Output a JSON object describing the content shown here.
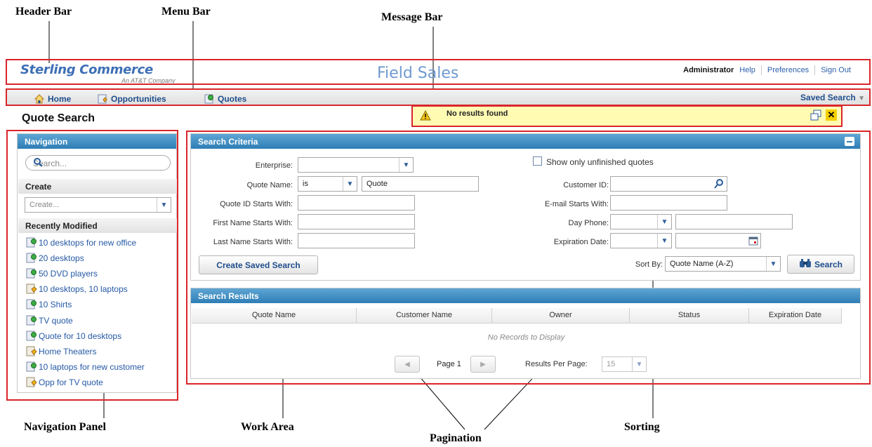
{
  "callouts": {
    "header_bar": "Header Bar",
    "menu_bar": "Menu Bar",
    "message_bar": "Message Bar",
    "navigation_panel": "Navigation Panel",
    "work_area": "Work Area",
    "pagination": "Pagination",
    "sorting": "Sorting"
  },
  "header": {
    "logo_main": "Sterling Commerce",
    "logo_sub": "An AT&T Company",
    "app_title": "Field Sales",
    "user": "Administrator",
    "links": [
      "Help",
      "Preferences",
      "Sign Out"
    ]
  },
  "menu": {
    "items": [
      "Home",
      "Opportunities",
      "Quotes"
    ],
    "saved_search": "Saved Search"
  },
  "message": {
    "text": "No results found",
    "icons": [
      "warning-icon",
      "popout-icon",
      "close-icon"
    ]
  },
  "page_title": "Quote Search",
  "navigation": {
    "title": "Navigation",
    "search_placeholder": "Search...",
    "create_header": "Create",
    "create_placeholder": "Create...",
    "recent_header": "Recently Modified",
    "recent": [
      {
        "label": "10 desktops for new office",
        "icon": "quote-icon"
      },
      {
        "label": "20 desktops",
        "icon": "quote-icon"
      },
      {
        "label": "50 DVD players",
        "icon": "quote-icon"
      },
      {
        "label": "10 desktops, 10 laptops",
        "icon": "opportunity-icon"
      },
      {
        "label": "10 Shirts",
        "icon": "quote-icon"
      },
      {
        "label": "TV quote",
        "icon": "quote-icon"
      },
      {
        "label": "Quote for 10 desktops",
        "icon": "quote-icon"
      },
      {
        "label": "Home Theaters",
        "icon": "opportunity-icon"
      },
      {
        "label": "10 laptops for new customer",
        "icon": "quote-icon"
      },
      {
        "label": "Opp for TV quote",
        "icon": "opportunity-icon"
      }
    ]
  },
  "search_criteria": {
    "title": "Search Criteria",
    "enterprise_label": "Enterprise:",
    "quote_name_label": "Quote Name:",
    "quote_name_operator": "is",
    "quote_name_value": "Quote",
    "quote_id_label": "Quote ID Starts With:",
    "first_name_label": "First Name Starts With:",
    "last_name_label": "Last Name Starts With:",
    "unfinished_label": "Show only unfinished quotes",
    "customer_id_label": "Customer ID:",
    "email_label": "E-mail Starts With:",
    "day_phone_label": "Day Phone:",
    "expiration_label": "Expiration Date:",
    "create_saved_search": "Create Saved Search",
    "sort_by_label": "Sort By:",
    "sort_by_value": "Quote Name (A-Z)",
    "search_button": "Search"
  },
  "search_results": {
    "title": "Search Results",
    "columns": [
      "Quote Name",
      "Customer Name",
      "Owner",
      "Status",
      "Expiration Date"
    ],
    "empty_text": "No Records to Display",
    "page_label": "Page 1",
    "results_per_page_label": "Results Per Page:",
    "results_per_page_value": "15"
  },
  "colors": {
    "annotation_red": "#d9262a",
    "panel_header_blue": "#2e7db5",
    "link_blue": "#2559a5",
    "message_yellow": "#fffbb3"
  }
}
